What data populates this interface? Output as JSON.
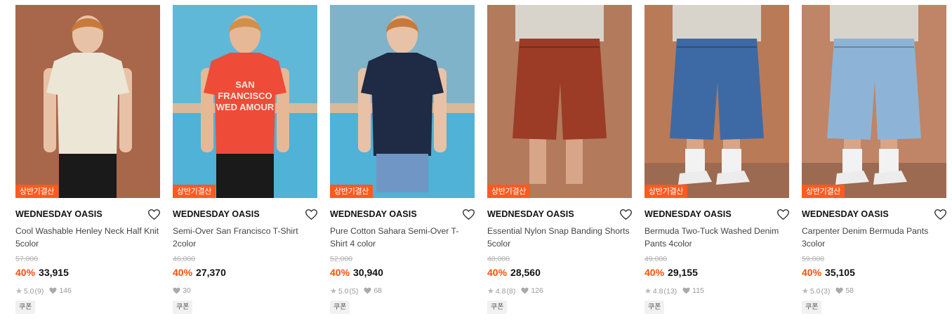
{
  "products": [
    {
      "badge": "상반기결산",
      "brand": "WEDNESDAY OASIS",
      "name": "Cool Washable Henley Neck Half Knit 5color",
      "original_price": "57,000",
      "discount": "40%",
      "price": "33,915",
      "rating": "5.0",
      "review_count": "(9)",
      "likes": "146",
      "coupon": "쿠폰",
      "image": {
        "bg": "#a8664a",
        "garment": "#ece6d6",
        "skin": "#e8c2a6",
        "hair": "#c77a3c",
        "type": "tee"
      }
    },
    {
      "badge": "상반기결산",
      "brand": "WEDNESDAY OASIS",
      "name": "Semi-Over San Francisco T-Shirt 2color",
      "original_price": "46,000",
      "discount": "40%",
      "price": "27,370",
      "rating": "",
      "review_count": "",
      "likes": "30",
      "coupon": "쿠폰",
      "image": {
        "bg": "#5fb8d8",
        "garment": "#ee4b38",
        "skin": "#e6b896",
        "hair": "#d0904a",
        "type": "tee",
        "print": [
          "SAN",
          "FRANCISCO",
          "WED AMOUR"
        ]
      }
    },
    {
      "badge": "상반기결산",
      "brand": "WEDNESDAY OASIS",
      "name": "Pure Cotton Sahara Semi-Over T-Shirt 4 color",
      "original_price": "52,000",
      "discount": "40%",
      "price": "30,940",
      "rating": "5.0",
      "review_count": "(5)",
      "likes": "68",
      "coupon": "쿠폰",
      "image": {
        "bg": "#7fb3c9",
        "garment": "#1f2a44",
        "skin": "#e8c2a6",
        "hair": "#c77a3c",
        "type": "tee-shorts"
      }
    },
    {
      "badge": "상반기결산",
      "brand": "WEDNESDAY OASIS",
      "name": "Essential Nylon Snap Banding Shorts 5color",
      "original_price": "48,000",
      "discount": "40%",
      "price": "28,560",
      "rating": "4.8",
      "review_count": "(8)",
      "likes": "126",
      "coupon": "쿠폰",
      "image": {
        "bg": "#b37a5c",
        "garment": "#9c3b26",
        "skin": "#d8a588",
        "type": "shorts"
      }
    },
    {
      "badge": "상반기결산",
      "brand": "WEDNESDAY OASIS",
      "name": "Bermuda Two-Tuck Washed Denim Pants 4color",
      "original_price": "49,000",
      "discount": "40%",
      "price": "29,155",
      "rating": "4.8",
      "review_count": "(13)",
      "likes": "115",
      "coupon": "쿠폰",
      "image": {
        "bg": "#b97a58",
        "garment": "#3d6aa5",
        "skin": "#d8a588",
        "type": "shorts-shoes"
      }
    },
    {
      "badge": "상반기결산",
      "brand": "WEDNESDAY OASIS",
      "name": "Carpenter Denim Bermuda Pants 3color",
      "original_price": "59,000",
      "discount": "40%",
      "price": "35,105",
      "rating": "5.0",
      "review_count": "(3)",
      "likes": "58",
      "coupon": "쿠폰",
      "image": {
        "bg": "#c08466",
        "garment": "#8db4d6",
        "skin": "#d8a588",
        "type": "shorts-side"
      }
    }
  ]
}
